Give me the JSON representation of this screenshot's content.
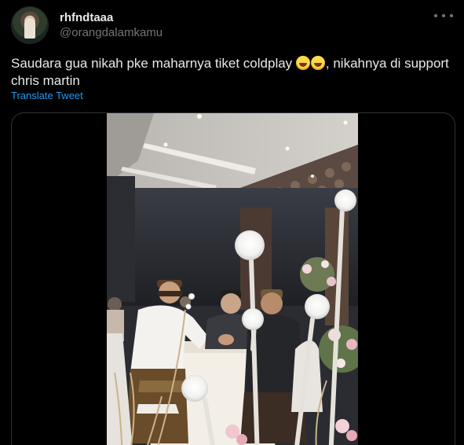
{
  "author": {
    "display_name": "rhfndtaaa",
    "handle": "@orangdalamkamu",
    "avatar_icon": "avatar-photo"
  },
  "tweet": {
    "text_part1": "Saudara gua nikah pke maharnya tiket coldplay ",
    "emojis": [
      "rolling-on-floor-laughing-emoji",
      "rolling-on-floor-laughing-emoji"
    ],
    "text_part2": ", nikahnya di support chris martin",
    "translate_label": "Translate Tweet"
  },
  "media": {
    "type": "video",
    "scene": "wedding-ceremony-video"
  },
  "colors": {
    "background": "#000000",
    "text": "#e7e9ea",
    "secondary": "#71767b",
    "link": "#1d9bf0",
    "border": "#2f3336"
  }
}
